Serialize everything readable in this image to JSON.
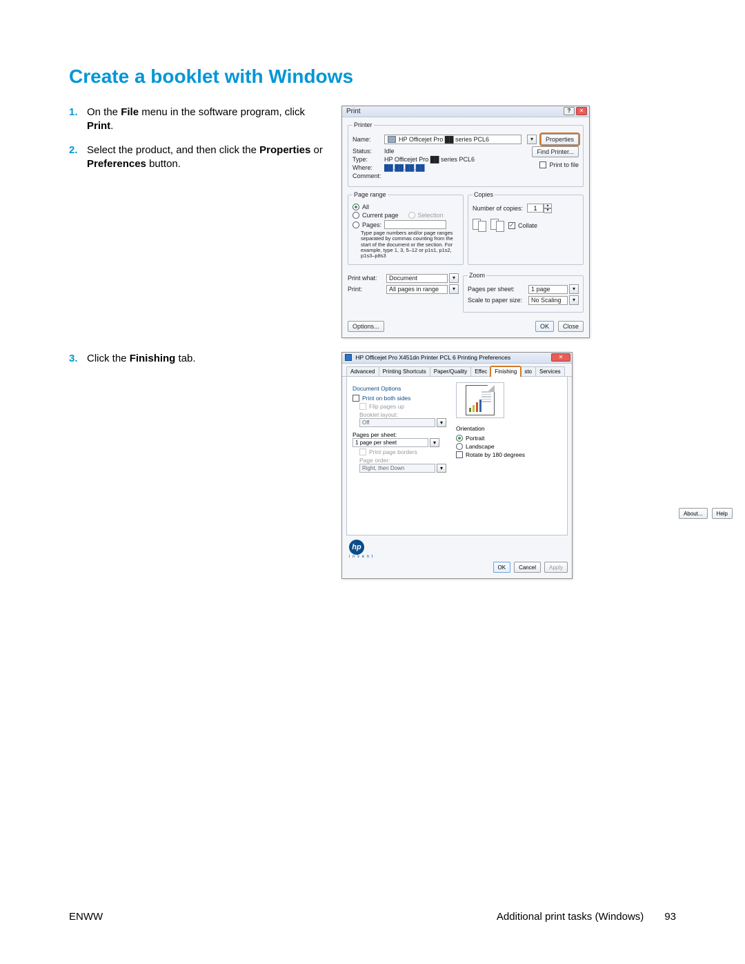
{
  "heading": "Create a booklet with Windows",
  "steps": {
    "s1": {
      "num": "1.",
      "pre": "On the ",
      "bold1": "File",
      "mid": " menu in the software program, click ",
      "bold2": "Print",
      "post": "."
    },
    "s2": {
      "num": "2.",
      "pre": "Select the product, and then click the ",
      "bold1": "Properties",
      "mid": " or ",
      "bold2": "Preferences",
      "post": " button."
    },
    "s3": {
      "num": "3.",
      "pre": "Click the ",
      "bold1": "Finishing",
      "post": " tab."
    }
  },
  "print": {
    "title": "Print",
    "printer_group": "Printer",
    "name_label": "Name:",
    "name_value": "HP Officejet Pro ██ series PCL6",
    "properties_btn": "Properties",
    "status_label": "Status:",
    "status_value": "Idle",
    "type_label": "Type:",
    "type_value": "HP Officejet Pro ██ series PCL6",
    "where_label": "Where:",
    "where_value": "██.██.██.██",
    "comment_label": "Comment:",
    "find_printer_btn": "Find Printer...",
    "print_to_file": "Print to file",
    "page_range_group": "Page range",
    "all": "All",
    "current_page": "Current page",
    "selection": "Selection",
    "pages": "Pages:",
    "pages_hint": "Type page numbers and/or page ranges separated by commas counting from the start of the document or the section. For example, type 1, 3, 5–12 or p1s1, p1s2, p1s3–p8s3",
    "copies_group": "Copies",
    "num_copies_label": "Number of copies:",
    "num_copies_value": "1",
    "collate": "Collate",
    "print_what_label": "Print what:",
    "print_what_value": "Document",
    "print_label": "Print:",
    "print_value": "All pages in range",
    "zoom_group": "Zoom",
    "pps_label": "Pages per sheet:",
    "pps_value": "1 page",
    "scale_label": "Scale to paper size:",
    "scale_value": "No Scaling",
    "options_btn": "Options...",
    "ok_btn": "OK",
    "close_btn": "Close"
  },
  "pref": {
    "title": "HP Officejet Pro X451dn Printer PCL 6 Printing Preferences",
    "tabs": {
      "advanced": "Advanced",
      "shortcuts": "Printing Shortcuts",
      "paper": "Paper/Quality",
      "effects": "Effec",
      "finishing": "Finishing",
      "job": "sto",
      "services": "Services"
    },
    "doc_options": "Document Options",
    "print_both": "Print on both sides",
    "flip_pages": "Flip pages up",
    "booklet_layout": "Booklet layout:",
    "booklet_value": "Off",
    "pps_label": "Pages per sheet:",
    "pps_value": "1 page per sheet",
    "print_borders": "Print page borders",
    "page_order": "Page order:",
    "page_order_value": "Right, then Down",
    "orientation": "Orientation",
    "portrait": "Portrait",
    "landscape": "Landscape",
    "rotate": "Rotate by 180 degrees",
    "about_btn": "About...",
    "help_btn": "Help",
    "ok": "OK",
    "cancel": "Cancel",
    "apply": "Apply",
    "hp_sub": "i n v e n t"
  },
  "footer": {
    "left": "ENWW",
    "center": "Additional print tasks (Windows)",
    "page": "93"
  }
}
